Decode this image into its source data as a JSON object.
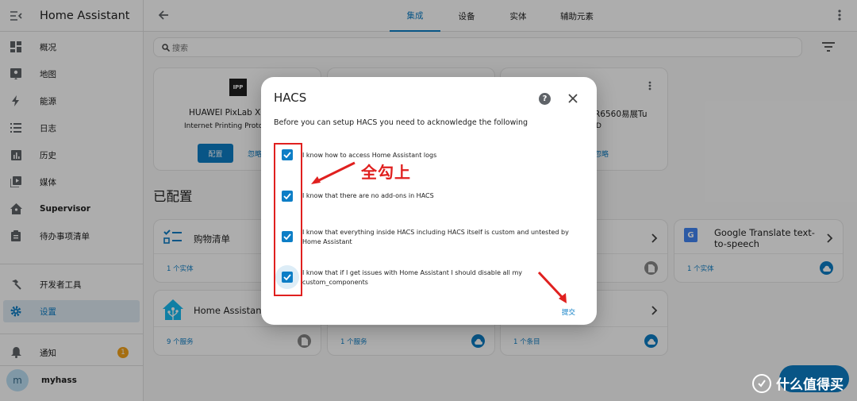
{
  "app": {
    "title": "Home Assistant"
  },
  "sidebar": {
    "items": [
      {
        "label": "概况",
        "icon": "dashboard-icon"
      },
      {
        "label": "地图",
        "icon": "map-icon"
      },
      {
        "label": "能源",
        "icon": "lightning-icon"
      },
      {
        "label": "日志",
        "icon": "list-icon"
      },
      {
        "label": "历史",
        "icon": "chart-icon"
      },
      {
        "label": "媒体",
        "icon": "media-icon"
      },
      {
        "label": "Supervisor",
        "icon": "home-assistant-icon"
      },
      {
        "label": "待办事项清单",
        "icon": "clipboard-icon"
      }
    ],
    "dev_tools": "开发者工具",
    "settings": "设置",
    "notifications": "通知",
    "notification_count": "1",
    "user_initial": "m",
    "user_name": "myhass"
  },
  "topbar": {
    "tabs": [
      "集成",
      "设备",
      "实体",
      "辅助元素"
    ],
    "active_tab": "集成"
  },
  "search": {
    "placeholder": "搜索"
  },
  "discovered": {
    "card1_title": "HUAWEI PixLab X1",
    "card1_subtitle": "Internet Printing Proto",
    "logo_text": "IPP",
    "configure": "配置",
    "ignore": "忽略",
    "card3_title": "R6560易展Tu",
    "card3_subtitle": "D",
    "card3_ignore": "忽略"
  },
  "configured": {
    "section_title": "已配置",
    "cards": [
      {
        "title": "购物清单",
        "footer": "1 个实体"
      },
      {
        "title": "Google Translate text-to-speech",
        "footer": "1 个实体"
      },
      {
        "title": "Home Assistant",
        "footer": "9 个服务"
      },
      {
        "footer": "1 个服务"
      },
      {
        "footer": "1 个条目"
      }
    ]
  },
  "dialog": {
    "title": "HACS",
    "intro": "Before you can setup HACS you need to acknowledge the following",
    "checks": [
      {
        "label": "I know how to access Home Assistant logs",
        "checked": true
      },
      {
        "label": "I know that there are no add-ons in HACS",
        "checked": true
      },
      {
        "label": "I know that everything inside HACS including HACS itself is custom and untested by Home Assistant",
        "checked": true
      },
      {
        "label": "I know that if I get issues with Home Assistant I should disable all my custom_components",
        "checked": true
      }
    ],
    "submit": "提交"
  },
  "annotation": {
    "text": "全勾上",
    "color": "#e0201f"
  },
  "watermark": {
    "text": "什么值得买"
  },
  "colors": {
    "accent": "#0d7ec6",
    "badge": "#f4a31a",
    "annotation": "#e0201f"
  }
}
